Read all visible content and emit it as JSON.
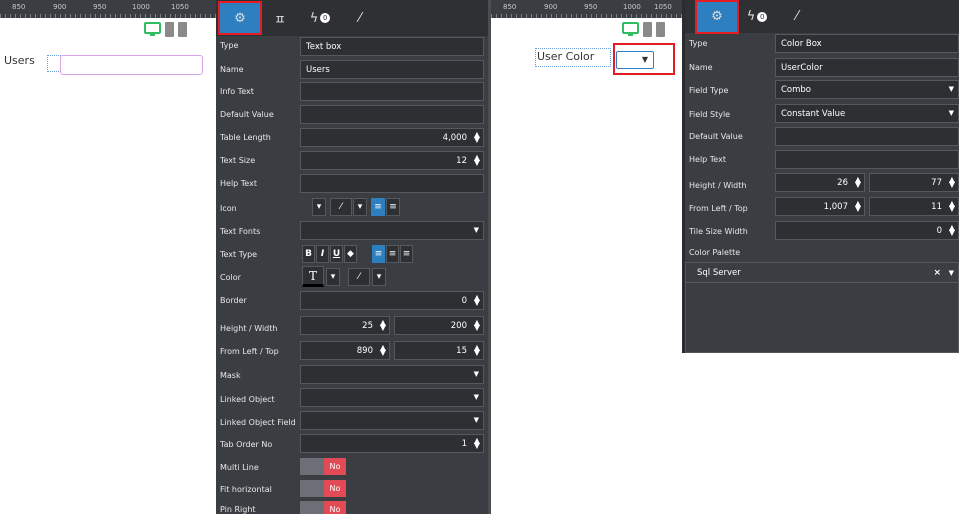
{
  "left": {
    "ruler_ticks": [
      "850",
      "900",
      "950",
      "1000",
      "1050"
    ],
    "canvas_label": "Users",
    "tabs": [
      "settings-icon",
      "pin-icon",
      "events-icon",
      "brush-icon"
    ],
    "events_badge": "0",
    "rows": {
      "type": {
        "label": "Type",
        "value": "Text box"
      },
      "name": {
        "label": "Name",
        "value": "Users"
      },
      "info": {
        "label": "Info Text",
        "value": ""
      },
      "default": {
        "label": "Default Value",
        "value": ""
      },
      "table_length": {
        "label": "Table Length",
        "value": "4,000"
      },
      "text_size": {
        "label": "Text Size",
        "value": "12"
      },
      "help": {
        "label": "Help Text",
        "value": ""
      },
      "icon": {
        "label": "Icon"
      },
      "text_fonts": {
        "label": "Text Fonts",
        "value": ""
      },
      "text_type": {
        "label": "Text Type"
      },
      "color": {
        "label": "Color"
      },
      "border": {
        "label": "Border",
        "value": "0"
      },
      "hw": {
        "label": "Height / Width",
        "h": "25",
        "w": "200"
      },
      "lt": {
        "label": "From Left / Top",
        "l": "890",
        "t": "15"
      },
      "mask": {
        "label": "Mask",
        "value": ""
      },
      "linked_obj": {
        "label": "Linked Object",
        "value": ""
      },
      "linked_field": {
        "label": "Linked Object Field",
        "value": ""
      },
      "tab_order": {
        "label": "Tab Order No",
        "value": "1"
      },
      "multi_line": {
        "label": "Multi Line",
        "value": "No"
      },
      "fit_h": {
        "label": "Fit horizontal",
        "value": "No"
      },
      "pin_right": {
        "label": "Pin Right",
        "value": "No"
      }
    },
    "format_buttons": {
      "bold": "B",
      "italic": "I",
      "underline": "U",
      "text_color": "T"
    }
  },
  "right": {
    "ruler_ticks": [
      "850",
      "900",
      "950",
      "1000",
      "1050"
    ],
    "canvas_label": "User Color",
    "events_badge": "0",
    "rows": {
      "type": {
        "label": "Type",
        "value": "Color Box"
      },
      "name": {
        "label": "Name",
        "value": "UserColor"
      },
      "field_type": {
        "label": "Field Type",
        "value": "Combo"
      },
      "field_style": {
        "label": "Field Style",
        "value": "Constant Value"
      },
      "default": {
        "label": "Default Value",
        "value": ""
      },
      "help": {
        "label": "Help Text",
        "value": ""
      },
      "hw": {
        "label": "Height / Width",
        "h": "26",
        "w": "77"
      },
      "lt": {
        "label": "From Left / Top",
        "l": "1,007",
        "t": "11"
      },
      "tile": {
        "label": "Tile Size Width",
        "value": "0"
      },
      "palette": {
        "label": "Color Palette",
        "value": "Sql Server"
      }
    }
  },
  "colors": {
    "accent": "#2e7fbf",
    "highlight": "#e41d24",
    "toggle_no": "#e24a55",
    "monitor": "#2ebd5f"
  }
}
